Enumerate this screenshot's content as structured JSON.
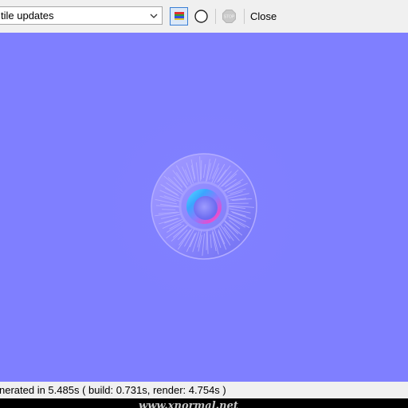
{
  "toolbar": {
    "dropdown_value": "tile updates",
    "close_label": "Close",
    "icons": {
      "chevron": "chevron-down-icon",
      "map_toggle": "color-map-icon",
      "circle": "circle-icon",
      "stop": "stop-icon",
      "stop_text": "STOP"
    }
  },
  "status": {
    "text": "nerated in 5.485s ( build: 0.731s, render: 4.754s )"
  },
  "footer": {
    "watermark": "www.xnormal.net"
  },
  "colors": {
    "normal_map_base": "#7f7fff",
    "toolbar_bg": "#f0f0f0",
    "accent": "#3a7fd5"
  }
}
